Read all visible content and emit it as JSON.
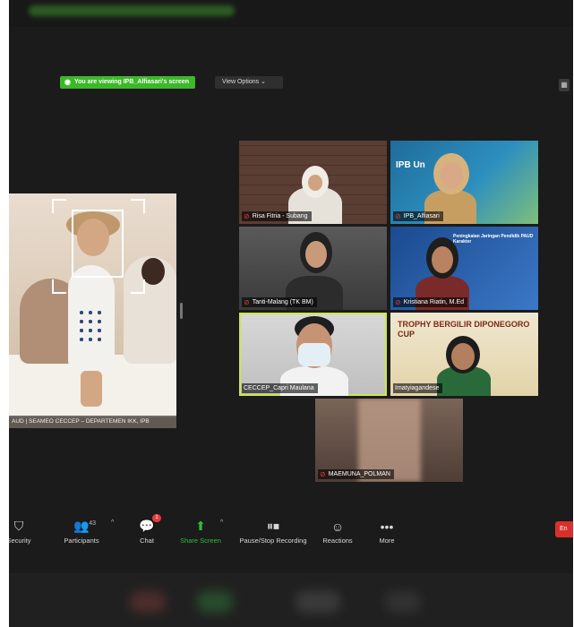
{
  "banner": {
    "viewing_text": "You are viewing IPB_Alfiasari's screen",
    "view_options_label": "View Options ⌄",
    "accent_color": "#3cb829"
  },
  "shared_screen": {
    "caption": "AUD | SEAMEO CECCEP – DEPARTEMEN IKK, IPB"
  },
  "participants": [
    {
      "name": "Risa Fitria - Subang"
    },
    {
      "name": "IPB_Alfiasari",
      "slide_text": "IPB Un"
    },
    {
      "name": "Tanti-Malang (TK BM)"
    },
    {
      "name": "Kristiana Riatin, M.Ed",
      "slide_text": "Peningkatan Jaringan Pendidik PAUD Karakter"
    },
    {
      "name": "CECCEP_Capri Maulana"
    },
    {
      "name": "Imatyiagandese",
      "slide_text": "TROPHY BERGILIR DIPONEGORO CUP"
    },
    {
      "name": "MAEMUNA_POLMAN"
    }
  ],
  "toolbar": {
    "security_label": "Security",
    "participants_label": "Participants",
    "participants_count": "43",
    "chat_label": "Chat",
    "chat_badge": "1",
    "share_label": "Share Screen",
    "record_label": "Pause/Stop Recording",
    "reactions_label": "Reactions",
    "more_label": "More",
    "end_label": "En"
  },
  "icons": {
    "security": "shield-icon",
    "participants": "people-icon",
    "chat": "chat-bubble-icon",
    "share": "share-screen-icon",
    "record": "pause-stop-icon",
    "reactions": "smiley-icon",
    "more": "ellipsis-icon",
    "mic_muted": "mic-muted-icon"
  }
}
